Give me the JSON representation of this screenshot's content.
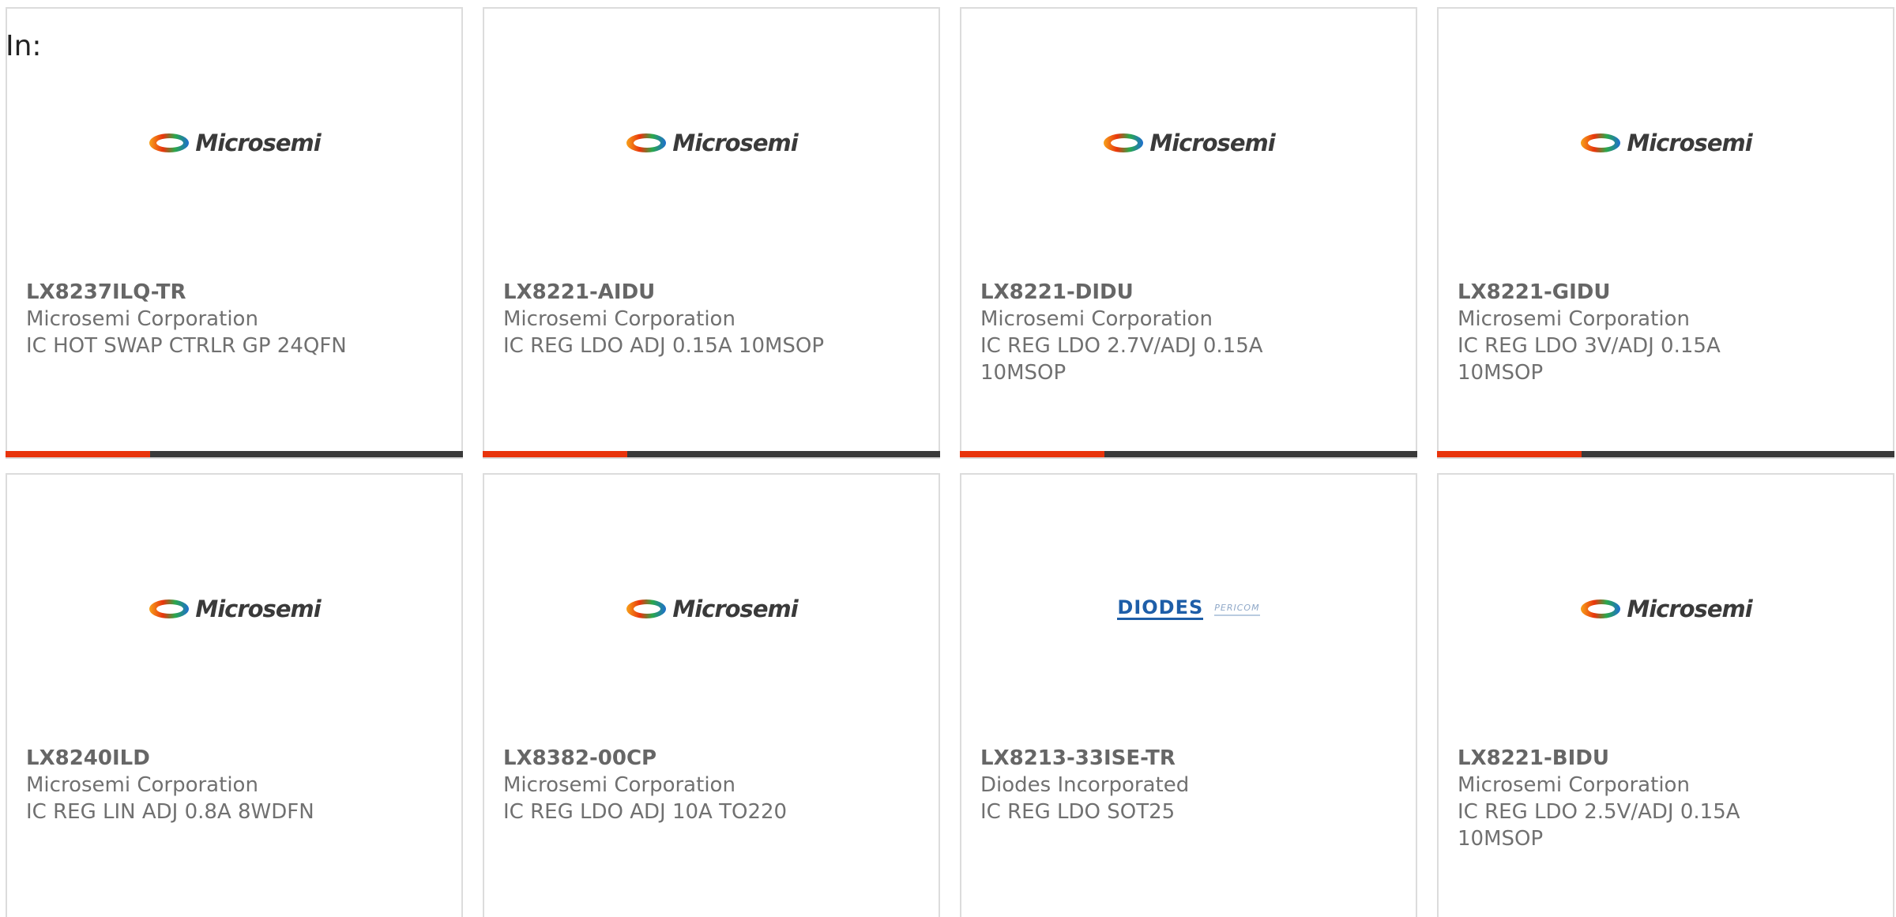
{
  "filter": {
    "label": "In:"
  },
  "colors": {
    "accent": "#e8340c",
    "bar": "#3a3a3a",
    "border": "#dcdcdc",
    "text": "#707070"
  },
  "products": [
    {
      "part": "LX8237ILQ-TR",
      "manufacturer": "Microsemi Corporation",
      "description": "IC HOT SWAP CTRLR GP 24QFN",
      "logo": "Microsemi"
    },
    {
      "part": "LX8221-AIDU",
      "manufacturer": "Microsemi Corporation",
      "description": "IC REG LDO ADJ 0.15A 10MSOP",
      "logo": "Microsemi"
    },
    {
      "part": "LX8221-DIDU",
      "manufacturer": "Microsemi Corporation",
      "description": "IC REG LDO 2.7V/ADJ 0.15A 10MSOP",
      "logo": "Microsemi"
    },
    {
      "part": "LX8221-GIDU",
      "manufacturer": "Microsemi Corporation",
      "description": "IC REG LDO 3V/ADJ 0.15A 10MSOP",
      "logo": "Microsemi"
    },
    {
      "part": "LX8240ILD",
      "manufacturer": "Microsemi Corporation",
      "description": "IC REG LIN ADJ 0.8A 8WDFN",
      "logo": "Microsemi"
    },
    {
      "part": "LX8382-00CP",
      "manufacturer": "Microsemi Corporation",
      "description": "IC REG LDO ADJ 10A TO220",
      "logo": "Microsemi"
    },
    {
      "part": "LX8213-33ISE-TR",
      "manufacturer": "Diodes Incorporated",
      "description": "IC REG LDO SOT25",
      "logo_primary": "DIODES",
      "logo_secondary": "PERICOM"
    },
    {
      "part": "LX8221-BIDU",
      "manufacturer": "Microsemi Corporation",
      "description": "IC REG LDO 2.5V/ADJ 0.15A 10MSOP",
      "logo": "Microsemi"
    }
  ]
}
